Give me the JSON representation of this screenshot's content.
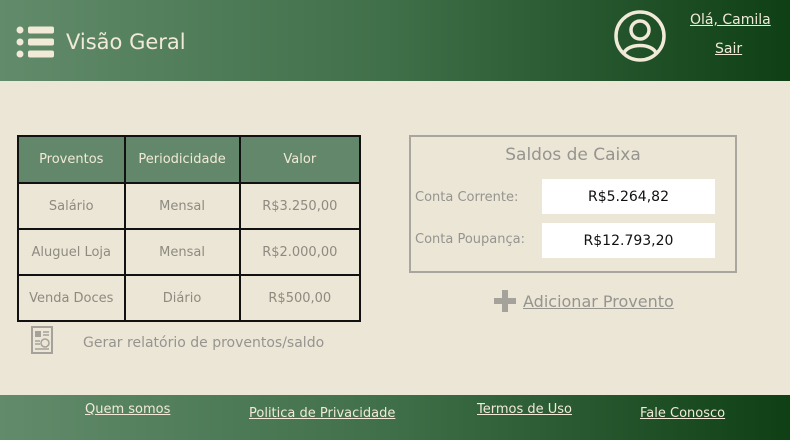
{
  "header": {
    "title": "Visão Geral",
    "greeting": "Olá, Camila",
    "logout": "Sair"
  },
  "proventos_table": {
    "headers": [
      "Proventos",
      "Periodicidade",
      "Valor"
    ],
    "rows": [
      [
        "Salário",
        "Mensal",
        "R$3.250,00"
      ],
      [
        "Aluguel Loja",
        "Mensal",
        "R$2.000,00"
      ],
      [
        "Venda Doces",
        "Diário",
        "R$500,00"
      ]
    ]
  },
  "saldos": {
    "title": "Saldos de Caixa",
    "corrente_label": "Conta Corrente:",
    "corrente_value": "R$5.264,82",
    "poupanca_label": "Conta Poupança:",
    "poupanca_value": "R$12.793,20"
  },
  "actions": {
    "add_provento": "Adicionar Provento",
    "report": "Gerar relatório de proventos/saldo"
  },
  "footer": {
    "links": [
      "Quem somos",
      "Politica de Privacidade",
      "Termos de Uso",
      "Fale Conosco"
    ]
  },
  "colors": {
    "header_start": "#628b6b",
    "header_end": "#0f3f14",
    "background": "#ece6d6",
    "table_header": "#62876a"
  }
}
